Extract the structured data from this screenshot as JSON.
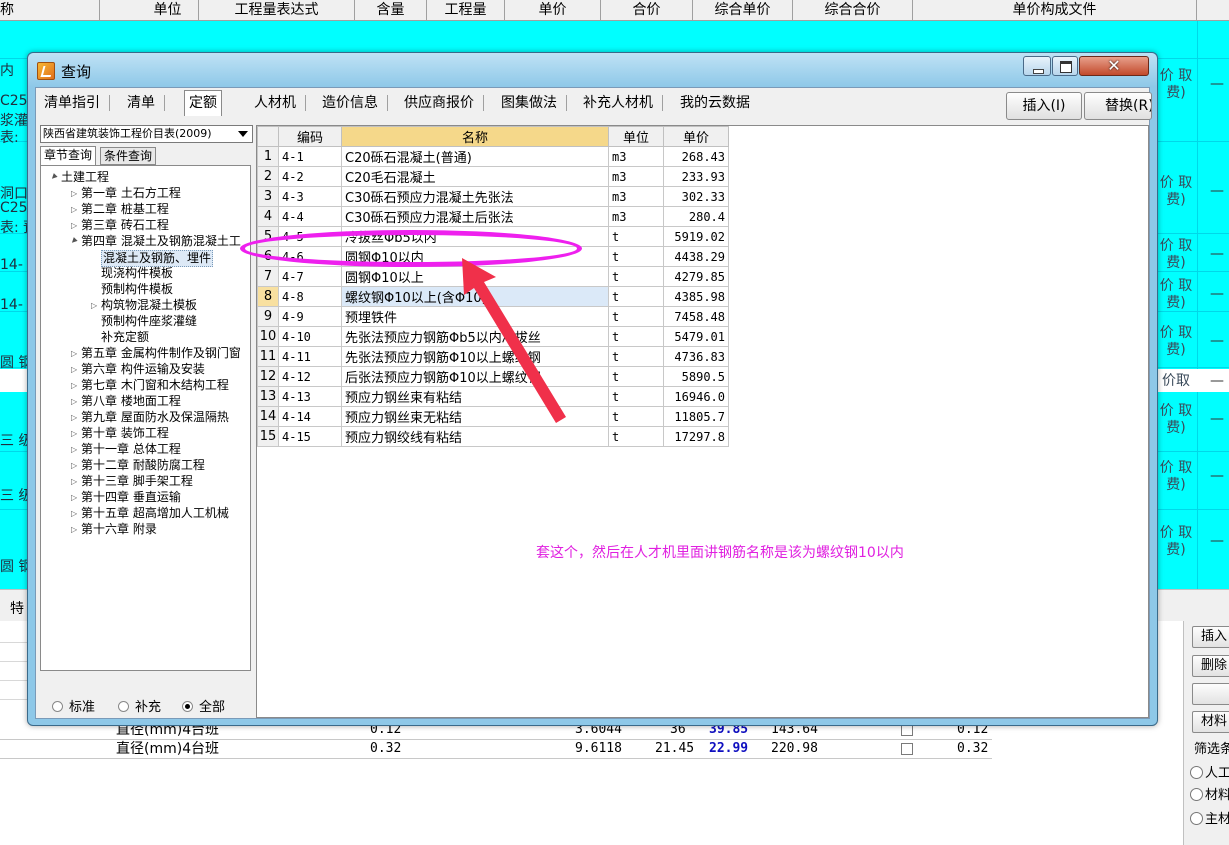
{
  "background": {
    "header_columns": [
      "称",
      "单位",
      "工程量表达式",
      "含量",
      "工程量",
      "单价",
      "合价",
      "综合单价",
      "综合合价",
      "单价构成文件"
    ],
    "left_fragments": [
      "内",
      "C25",
      "浆灌",
      "表:",
      "洞口",
      "C25",
      "表: 预",
      "14-",
      "14-",
      "圆 钢",
      "三 级",
      "三 级",
      "圆 钢"
    ],
    "right_fragments": [
      "价 取费)",
      "价 取费)",
      "价 取费)",
      "价 取费)",
      "价 取费)",
      "价取",
      "价 取费)",
      "价 取费)",
      "价 取费)"
    ],
    "right_dashes": [
      "—",
      "—",
      "—",
      "—",
      "—",
      "—",
      "—",
      "—",
      "—"
    ],
    "tab_fragment": "特",
    "lower_rows": [
      {
        "name": "直径(mm)4",
        "unit": "台班",
        "qty": "0.12",
        "price": "3.6044",
        "v1": "36",
        "v2": "39.85",
        "v3": "143.64",
        "v4": "0.12"
      },
      {
        "name": "直径(mm)4",
        "unit": "台班",
        "qty": "0.32",
        "price": "9.6118",
        "v1": "21.45",
        "v2": "22.99",
        "v3": "220.98",
        "v4": "0.32"
      }
    ],
    "right_panel": {
      "buttons": [
        "插入",
        "删除",
        "",
        "材料"
      ],
      "filter_label": "筛选条",
      "radios": [
        "人工",
        "材料",
        "主材"
      ]
    }
  },
  "dialog": {
    "title": "查询",
    "tabs": [
      "清单指引",
      "清单",
      "定额",
      "人材机",
      "造价信息",
      "供应商报价",
      "图集做法",
      "补充人材机",
      "我的云数据"
    ],
    "active_tab": "定额",
    "insert_button": "插入(I)",
    "replace_button": "替换(R)",
    "library_select": "陕西省建筑装饰工程价目表(2009)",
    "subtabs": [
      "章节查询",
      "条件查询"
    ],
    "tree": [
      {
        "label": "土建工程",
        "level": 0,
        "expander": "open"
      },
      {
        "label": "第一章 土石方工程",
        "level": 1,
        "expander": "closed"
      },
      {
        "label": "第二章 桩基工程",
        "level": 1,
        "expander": "closed"
      },
      {
        "label": "第三章 砖石工程",
        "level": 1,
        "expander": "closed"
      },
      {
        "label": "第四章 混凝土及钢筋混凝土工",
        "level": 1,
        "expander": "open"
      },
      {
        "label": "混凝土及钢筋、埋件",
        "level": 2,
        "expander": "none",
        "selected": true
      },
      {
        "label": "现浇构件模板",
        "level": 2,
        "expander": "none"
      },
      {
        "label": "预制构件模板",
        "level": 2,
        "expander": "none"
      },
      {
        "label": "构筑物混凝土模板",
        "level": 2,
        "expander": "closed"
      },
      {
        "label": "预制构件座浆灌缝",
        "level": 2,
        "expander": "none"
      },
      {
        "label": "补充定额",
        "level": 2,
        "expander": "none"
      },
      {
        "label": "第五章 金属构件制作及钢门窗",
        "level": 1,
        "expander": "closed"
      },
      {
        "label": "第六章 构件运输及安装",
        "level": 1,
        "expander": "closed"
      },
      {
        "label": "第七章 木门窗和木结构工程",
        "level": 1,
        "expander": "closed"
      },
      {
        "label": "第八章 楼地面工程",
        "level": 1,
        "expander": "closed"
      },
      {
        "label": "第九章 屋面防水及保温隔热",
        "level": 1,
        "expander": "closed"
      },
      {
        "label": "第十章 装饰工程",
        "level": 1,
        "expander": "closed"
      },
      {
        "label": "第十一章 总体工程",
        "level": 1,
        "expander": "closed"
      },
      {
        "label": "第十二章 耐酸防腐工程",
        "level": 1,
        "expander": "closed"
      },
      {
        "label": "第十三章 脚手架工程",
        "level": 1,
        "expander": "closed"
      },
      {
        "label": "第十四章 垂直运输",
        "level": 1,
        "expander": "closed"
      },
      {
        "label": "第十五章 超高增加人工机械",
        "level": 1,
        "expander": "closed"
      },
      {
        "label": "第十六章 附录",
        "level": 1,
        "expander": "closed"
      }
    ],
    "filter_radios": [
      {
        "label": "标准",
        "checked": false
      },
      {
        "label": "补充",
        "checked": false
      },
      {
        "label": "全部",
        "checked": true
      }
    ],
    "grid": {
      "headers": [
        "",
        "编码",
        "名称",
        "单位",
        "单价"
      ],
      "rows": [
        {
          "no": "1",
          "code": "4-1",
          "name": "C20砾石混凝土(普通)",
          "unit": "m3",
          "price": "268.43"
        },
        {
          "no": "2",
          "code": "4-2",
          "name": "C20毛石混凝土",
          "unit": "m3",
          "price": "233.93"
        },
        {
          "no": "3",
          "code": "4-3",
          "name": "C30砾石预应力混凝土先张法",
          "unit": "m3",
          "price": "302.33"
        },
        {
          "no": "4",
          "code": "4-4",
          "name": "C30砾石预应力混凝土后张法",
          "unit": "m3",
          "price": "280.4"
        },
        {
          "no": "5",
          "code": "4-5",
          "name": "冷拔丝Φb5以内",
          "unit": "t",
          "price": "5919.02"
        },
        {
          "no": "6",
          "code": "4-6",
          "name": "圆钢Φ10以内",
          "unit": "t",
          "price": "4438.29"
        },
        {
          "no": "7",
          "code": "4-7",
          "name": "圆钢Φ10以上",
          "unit": "t",
          "price": "4279.85"
        },
        {
          "no": "8",
          "code": "4-8",
          "name": "螺纹钢Φ10以上(含Φ10)",
          "unit": "t",
          "price": "4385.98"
        },
        {
          "no": "9",
          "code": "4-9",
          "name": "预埋铁件",
          "unit": "t",
          "price": "7458.48"
        },
        {
          "no": "10",
          "code": "4-10",
          "name": "先张法预应力钢筋Φb5以内冷拔丝",
          "unit": "t",
          "price": "5479.01"
        },
        {
          "no": "11",
          "code": "4-11",
          "name": "先张法预应力钢筋Φ10以上螺纹钢",
          "unit": "t",
          "price": "4736.83"
        },
        {
          "no": "12",
          "code": "4-12",
          "name": "后张法预应力钢筋Φ10以上螺纹钢",
          "unit": "t",
          "price": "5890.5"
        },
        {
          "no": "13",
          "code": "4-13",
          "name": "预应力钢丝束有粘结",
          "unit": "t",
          "price": "16946.0"
        },
        {
          "no": "14",
          "code": "4-14",
          "name": "预应力钢丝束无粘结",
          "unit": "t",
          "price": "11805.7"
        },
        {
          "no": "15",
          "code": "4-15",
          "name": "预应力钢绞线有粘结",
          "unit": "t",
          "price": "17297.8"
        }
      ],
      "selected_row": "8"
    },
    "annotation": {
      "text": "套这个，然后在人才机里面讲钢筋名称是该为螺纹钢10以内",
      "color": "#e020e0"
    }
  }
}
